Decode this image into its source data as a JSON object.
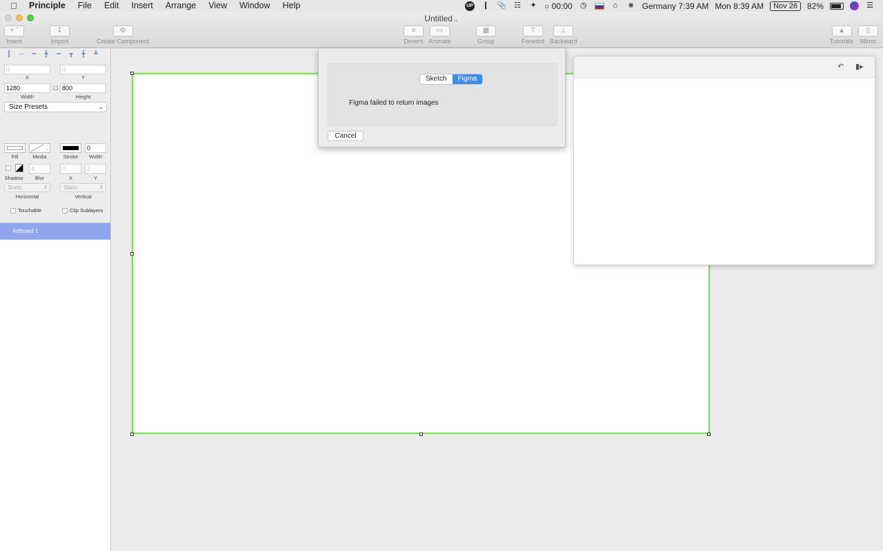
{
  "menubar": {
    "app_name": "Principle",
    "items": [
      "File",
      "Edit",
      "Insert",
      "Arrange",
      "View",
      "Window",
      "Help"
    ],
    "up_badge": "UP",
    "timer": "00:00",
    "clock_world": "Germany 7:39 AM",
    "clock_local": "Mon 8:39 AM",
    "date_badge": "Nov 26",
    "battery": "82%"
  },
  "window": {
    "title": "Untitled",
    "toolbar": {
      "insert": "Insert",
      "import": "Import",
      "create_component": "Create Component",
      "drivers": "Drivers",
      "animate": "Animate",
      "group": "Group",
      "forward": "Forward",
      "backward": "Backward",
      "tutorials": "Tutorials",
      "mirror": "Mirror"
    }
  },
  "inspector": {
    "x": {
      "value": "0",
      "label": "X"
    },
    "y": {
      "value": "0",
      "label": "Y"
    },
    "width": {
      "value": "1280",
      "label": "Width"
    },
    "height": {
      "value": "800",
      "label": "Height"
    },
    "size_presets": "Size Presets",
    "fill_label": "Fill",
    "media_label": "Media",
    "stroke_label": "Stroke",
    "stroke_width": {
      "value": "0",
      "label": "Width"
    },
    "shadow_label": "Shadow",
    "blur": {
      "value": "4",
      "label": "Blur"
    },
    "shadow_x": {
      "value": "0",
      "label": "X"
    },
    "shadow_y": {
      "value": "2",
      "label": "Y"
    },
    "horizontal": {
      "value": "Static",
      "label": "Horizontal"
    },
    "vertical": {
      "value": "Static",
      "label": "Vertical"
    },
    "touchable": "Touchable",
    "clip_sublayers": "Clip Sublayers"
  },
  "layers": [
    "Artboard 1"
  ],
  "import_sheet": {
    "tabs": [
      "Sketch",
      "Figma"
    ],
    "active_tab": "Figma",
    "message": "Figma failed to return images",
    "cancel": "Cancel"
  },
  "colors": {
    "accent": "#3b8ef0",
    "selection": "#78e05a",
    "layer_highlight": "#8fa6ee"
  }
}
